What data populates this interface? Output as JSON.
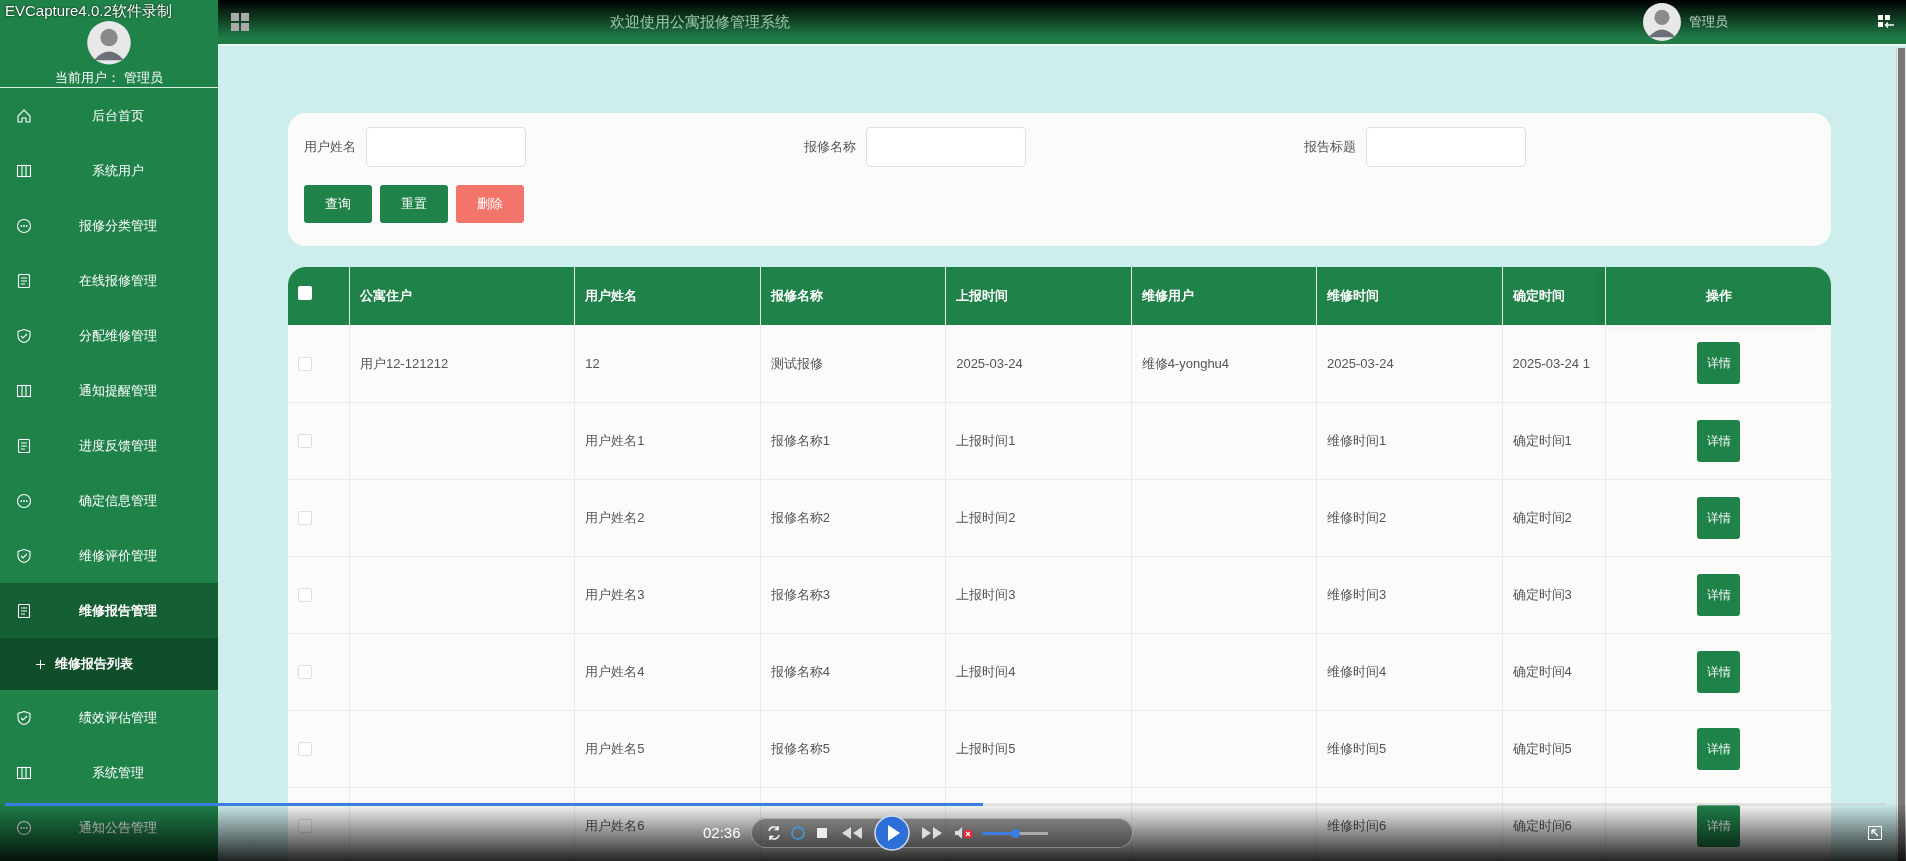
{
  "recorder": {
    "title": "EVCapture4.0.2软件录制",
    "time": "02:36",
    "progress": {
      "level": 0.52
    },
    "volume": {
      "level": 0.5
    }
  },
  "sidebar": {
    "user_label": "当前用户：",
    "user_name": "管理员",
    "items": [
      {
        "label": "后台首页",
        "kind": "home",
        "selected": false
      },
      {
        "label": "系统用户",
        "kind": "columns",
        "selected": false
      },
      {
        "label": "报修分类管理",
        "kind": "chat",
        "selected": false
      },
      {
        "label": "在线报修管理",
        "kind": "doc",
        "selected": false
      },
      {
        "label": "分配维修管理",
        "kind": "shield",
        "selected": false
      },
      {
        "label": "通知提醒管理",
        "kind": "columns",
        "selected": false
      },
      {
        "label": "进度反馈管理",
        "kind": "doc",
        "selected": false
      },
      {
        "label": "确定信息管理",
        "kind": "chat",
        "selected": false
      },
      {
        "label": "维修评价管理",
        "kind": "shield",
        "selected": false
      },
      {
        "label": "维修报告管理",
        "kind": "doc",
        "selected": true,
        "children": [
          {
            "label": "维修报告列表"
          }
        ]
      },
      {
        "label": "绩效评估管理",
        "kind": "shield",
        "selected": false
      },
      {
        "label": "系统管理",
        "kind": "columns",
        "selected": false
      },
      {
        "label": "通知公告管理",
        "kind": "chat",
        "selected": false
      }
    ]
  },
  "topbar": {
    "title": "欢迎使用公寓报修管理系统",
    "user": "管理员"
  },
  "filters": {
    "fields": [
      {
        "label": "用户姓名"
      },
      {
        "label": "报修名称"
      },
      {
        "label": "报告标题"
      }
    ],
    "buttons": [
      {
        "label": "查询",
        "kind": "primary"
      },
      {
        "label": "重置",
        "kind": "primary"
      },
      {
        "label": "删除",
        "kind": "danger"
      }
    ]
  },
  "table": {
    "select_all": {
      "checked": false
    },
    "columns": [
      "公寓住户",
      "用户姓名",
      "报修名称",
      "上报时间",
      "维修用户",
      "维修时间",
      "确定时间",
      "操作"
    ],
    "rows": [
      {
        "checked": false,
        "cells": [
          "用户12-121212",
          "12",
          "测试报修",
          "2025-03-24",
          "维修4-yonghu4",
          "2025-03-24",
          "2025-03-24 1"
        ],
        "action": "详情"
      },
      {
        "checked": false,
        "cells": [
          null,
          "用户姓名1",
          "报修名称1",
          "上报时间1",
          null,
          "维修时间1",
          "确定时间1"
        ],
        "action": "详情"
      },
      {
        "checked": false,
        "cells": [
          null,
          "用户姓名2",
          "报修名称2",
          "上报时间2",
          null,
          "维修时间2",
          "确定时间2"
        ],
        "action": "详情"
      },
      {
        "checked": false,
        "cells": [
          null,
          "用户姓名3",
          "报修名称3",
          "上报时间3",
          null,
          "维修时间3",
          "确定时间3"
        ],
        "action": "详情"
      },
      {
        "checked": false,
        "cells": [
          null,
          "用户姓名4",
          "报修名称4",
          "上报时间4",
          null,
          "维修时间4",
          "确定时间4"
        ],
        "action": "详情"
      },
      {
        "checked": false,
        "cells": [
          null,
          "用户姓名5",
          "报修名称5",
          "上报时间5",
          null,
          "维修时间5",
          "确定时间5"
        ],
        "action": "详情"
      },
      {
        "checked": false,
        "cells": [
          null,
          "用户姓名6",
          null,
          null,
          null,
          "维修时间6",
          "确定时间6"
        ],
        "action": "详情"
      }
    ]
  }
}
